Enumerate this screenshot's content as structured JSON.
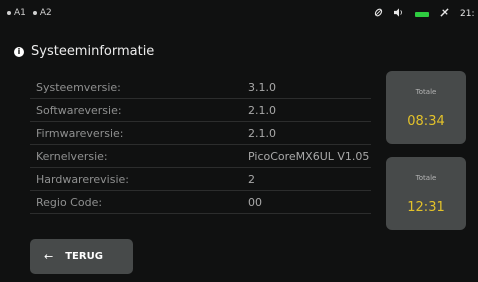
{
  "statusbar": {
    "items": [
      {
        "label": "A1"
      },
      {
        "label": "A2"
      }
    ],
    "icons": [
      "leaf-icon",
      "speaker-icon",
      "battery-icon",
      "plug-icon"
    ],
    "time_partial": "21:",
    "battery_color": "#2ecc40"
  },
  "page": {
    "title": "Systeeminformatie",
    "info_icon": "info-icon"
  },
  "info": [
    {
      "label": "Systeemversie:",
      "value": "3.1.0"
    },
    {
      "label": "Softwareversie:",
      "value": "2.1.0"
    },
    {
      "label": "Firmwareversie:",
      "value": "2.1.0"
    },
    {
      "label": "Kernelversie:",
      "value": "PicoCoreMX6UL V1.05"
    },
    {
      "label": "Hardwarerevisie:",
      "value": "2"
    },
    {
      "label": "Regio Code:",
      "value": "00"
    }
  ],
  "tiles": [
    {
      "label": "Totale",
      "value": "08:34"
    },
    {
      "label": "Totale",
      "value": "12:31"
    }
  ],
  "back_button": {
    "label": "TERUG",
    "icon": "arrow-left-icon"
  },
  "colors": {
    "accent": "#e3c22a",
    "tile_bg": "#474a4a",
    "background": "#101111"
  }
}
